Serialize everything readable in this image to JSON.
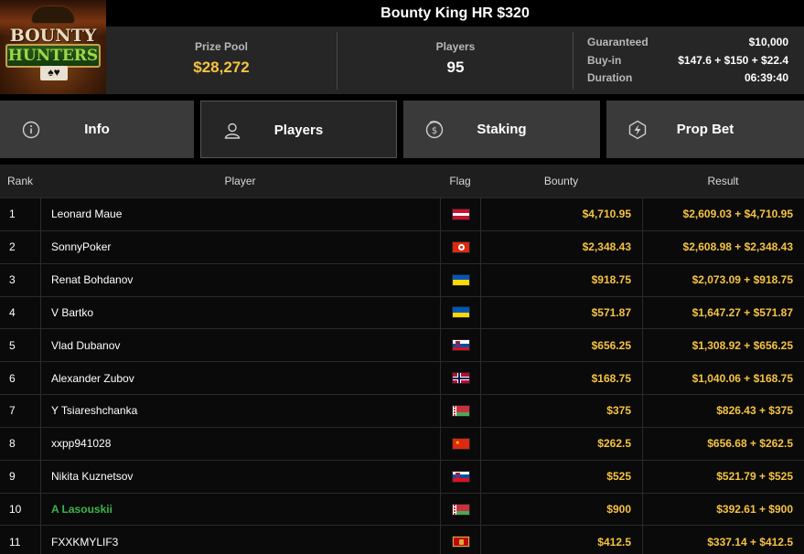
{
  "header": {
    "title": "Bounty King HR $320",
    "logo_text_top": "BOUNTY",
    "logo_text_bottom": "HUNTERS",
    "logo_cards": "♠♥"
  },
  "stats": {
    "prize_pool_label": "Prize Pool",
    "prize_pool_value": "$28,272",
    "players_label": "Players",
    "players_value": "95",
    "details": [
      {
        "key": "Guaranteed",
        "value": "$10,000"
      },
      {
        "key": "Buy-in",
        "value": "$147.6 + $150 + $22.4"
      },
      {
        "key": "Duration",
        "value": "06:39:40"
      }
    ]
  },
  "tabs": [
    {
      "label": "Info",
      "icon": "info-icon"
    },
    {
      "label": "Players",
      "icon": "user-icon",
      "active": true
    },
    {
      "label": "Staking",
      "icon": "dollar-coin-icon"
    },
    {
      "label": "Prop Bet",
      "icon": "lightning-icon"
    }
  ],
  "table": {
    "columns": {
      "rank": "Rank",
      "player": "Player",
      "flag": "Flag",
      "bounty": "Bounty",
      "result": "Result"
    },
    "rows": [
      {
        "rank": "1",
        "player": "Leonard Maue",
        "flag": "austria",
        "bounty": "$4,710.95",
        "result": "$2,609.03 + $4,710.95"
      },
      {
        "rank": "2",
        "player": "SonnyPoker",
        "flag": "hong-kong",
        "bounty": "$2,348.43",
        "result": "$2,608.98 + $2,348.43"
      },
      {
        "rank": "3",
        "player": "Renat Bohdanov",
        "flag": "ukraine",
        "bounty": "$918.75",
        "result": "$2,073.09 + $918.75"
      },
      {
        "rank": "4",
        "player": "V Bartko",
        "flag": "ukraine",
        "bounty": "$571.87",
        "result": "$1,647.27 + $571.87"
      },
      {
        "rank": "5",
        "player": "Vlad Dubanov",
        "flag": "slovenia",
        "bounty": "$656.25",
        "result": "$1,308.92 + $656.25"
      },
      {
        "rank": "6",
        "player": "Alexander Zubov",
        "flag": "norway",
        "bounty": "$168.75",
        "result": "$1,040.06 + $168.75"
      },
      {
        "rank": "7",
        "player": "Y Tsiareshchanka",
        "flag": "belarus",
        "bounty": "$375",
        "result": "$826.43 + $375"
      },
      {
        "rank": "8",
        "player": "xxpp941028",
        "flag": "china",
        "bounty": "$262.5",
        "result": "$656.68 + $262.5"
      },
      {
        "rank": "9",
        "player": "Nikita Kuznetsov",
        "flag": "slovenia",
        "bounty": "$525",
        "result": "$521.79 + $525"
      },
      {
        "rank": "10",
        "player": "A Lasouskii",
        "flag": "belarus",
        "bounty": "$900",
        "result": "$392.61 + $900",
        "highlight": true
      },
      {
        "rank": "11",
        "player": "FXXKMYLIF3",
        "flag": "montenegro",
        "bounty": "$412.5",
        "result": "$337.14 + $412.5"
      }
    ]
  },
  "colors": {
    "gold": "#f6c342",
    "green": "#3cb44b",
    "panel": "#262626",
    "tab": "#3a3a3a"
  }
}
